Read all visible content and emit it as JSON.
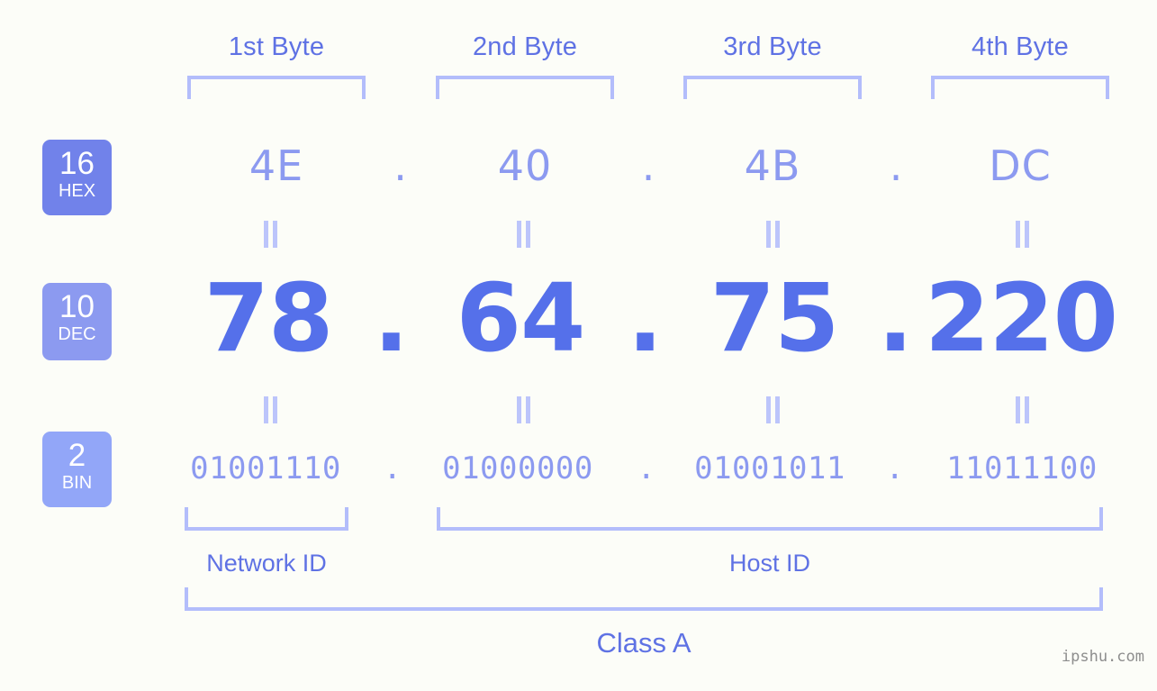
{
  "background_color": "#fcfdf8",
  "accent_color": "#5f72e4",
  "light_accent_color": "#8c9af0",
  "bracket_color": "#b3bdfb",
  "byte_headers": [
    {
      "label": "1st Byte"
    },
    {
      "label": "2nd Byte"
    },
    {
      "label": "3rd Byte"
    },
    {
      "label": "4th Byte"
    }
  ],
  "bases": [
    {
      "number": "16",
      "name": "HEX",
      "color": "#7182ea"
    },
    {
      "number": "10",
      "name": "DEC",
      "color": "#8c9af0"
    },
    {
      "number": "2",
      "name": "BIN",
      "color": "#92a6f8"
    }
  ],
  "rows": {
    "hex": {
      "base_number": "16",
      "base_name": "HEX",
      "values": [
        "4E",
        "40",
        "4B",
        "DC"
      ],
      "separator": "."
    },
    "dec": {
      "base_number": "10",
      "base_name": "DEC",
      "values": [
        "78",
        "64",
        "75",
        "220"
      ],
      "separator": "."
    },
    "bin": {
      "base_number": "2",
      "base_name": "BIN",
      "values": [
        "01001110",
        "01000000",
        "01001011",
        "11011100"
      ],
      "separator": "."
    }
  },
  "equality_marks": {
    "symbol": "="
  },
  "sections": [
    {
      "label": "Network ID"
    },
    {
      "label": "Host ID"
    }
  ],
  "class_label": "Class A",
  "watermark": "ipshu.com"
}
